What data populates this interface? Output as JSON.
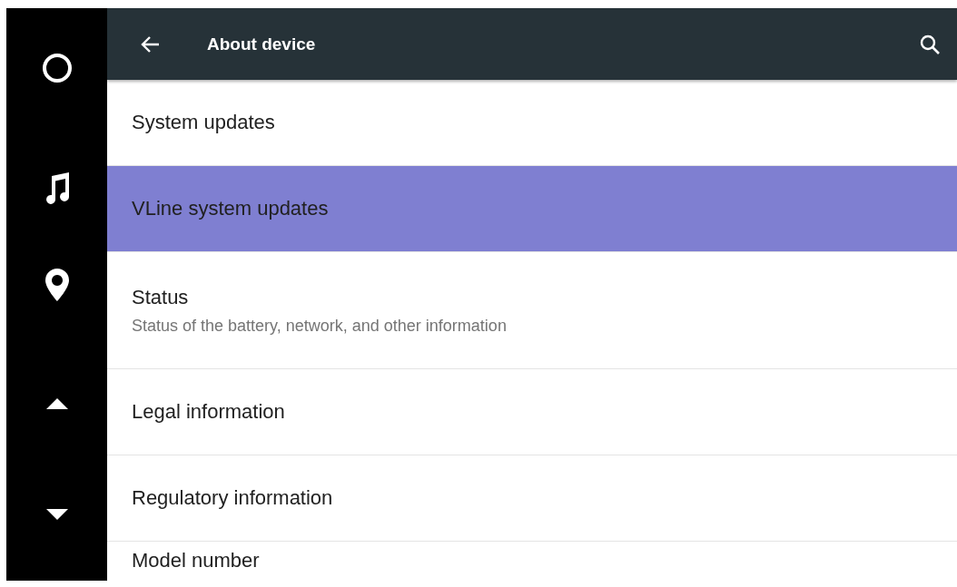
{
  "header": {
    "title": "About device"
  },
  "settings": [
    {
      "title": "System updates",
      "selected": false
    },
    {
      "title": "VLine system updates",
      "selected": true
    },
    {
      "title": "Status",
      "summary": "Status of the battery, network, and other information",
      "selected": false
    },
    {
      "title": "Legal information",
      "selected": false
    },
    {
      "title": "Regulatory information",
      "selected": false
    },
    {
      "title": "Model number",
      "selected": false
    }
  ]
}
